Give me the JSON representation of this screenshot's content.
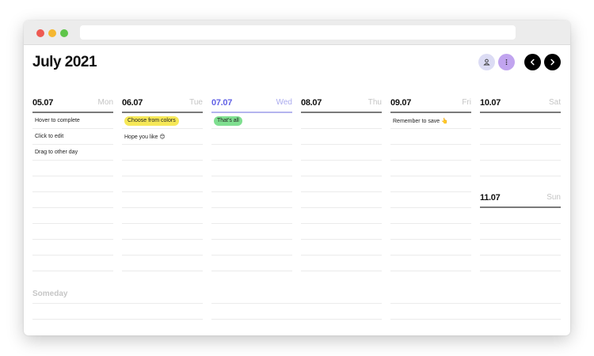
{
  "app": {
    "title": "July 2021"
  },
  "header_buttons": {
    "user": "user-icon",
    "more": "more-icon",
    "prev": "chevron-left-icon",
    "next": "chevron-right-icon"
  },
  "days": [
    {
      "date": "05.07",
      "day": "Mon",
      "tasks": [
        {
          "text": "Hover to complete",
          "color": ""
        },
        {
          "text": "Click to edit",
          "color": ""
        },
        {
          "text": "Drag to other day",
          "color": ""
        }
      ]
    },
    {
      "date": "06.07",
      "day": "Tue",
      "tasks": [
        {
          "text": "Choose from colors",
          "color": "#f6e857"
        },
        {
          "text": "Hope you like 😊",
          "color": ""
        }
      ]
    },
    {
      "date": "07.07",
      "day": "Wed",
      "today": true,
      "tasks": [
        {
          "text": "That's all",
          "color": "#7fdf90"
        }
      ]
    },
    {
      "date": "08.07",
      "day": "Thu",
      "tasks": []
    },
    {
      "date": "09.07",
      "day": "Fri",
      "tasks": [
        {
          "text": "Remember to save 👆",
          "color": ""
        }
      ]
    },
    {
      "date": "10.07",
      "day": "Sat",
      "tasks": []
    },
    {
      "date": "11.07",
      "day": "Sun",
      "tasks": []
    }
  ],
  "someday": {
    "label": "Someday"
  },
  "colors": {
    "accent_today": "#6262e6",
    "tag_yellow": "#f6e857",
    "tag_green": "#7fdf90",
    "more_button": "#c1a4ef",
    "user_button": "#dcdcf4"
  }
}
